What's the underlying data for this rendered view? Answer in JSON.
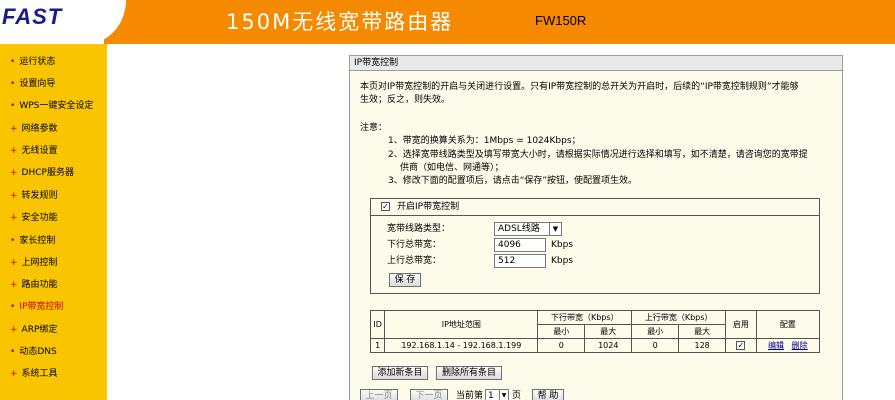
{
  "header": {
    "logo_text": "FAST",
    "title": "150M无线宽带路由器",
    "model": "FW150R",
    "brand_color": "#f58a00"
  },
  "sidebar": {
    "items": [
      {
        "label": "运行状态"
      },
      {
        "label": "设置向导"
      },
      {
        "label": "WPS一键安全设定"
      },
      {
        "label": "网络参数"
      },
      {
        "label": "无线设置"
      },
      {
        "label": "DHCP服务器"
      },
      {
        "label": "转发规则"
      },
      {
        "label": "安全功能"
      },
      {
        "label": "家长控制"
      },
      {
        "label": "上网控制"
      },
      {
        "label": "路由功能"
      },
      {
        "label": "IP带宽控制",
        "active": true
      },
      {
        "label": "ARP绑定"
      },
      {
        "label": "动态DNS"
      },
      {
        "label": "系统工具"
      }
    ]
  },
  "panel": {
    "title": "IP带宽控制",
    "intro_line1": "本页对IP带宽控制的开启与关闭进行设置。只有IP带宽控制的总开关为开启时，后续的“IP带宽控制规则”才能够",
    "intro_line2": "生效；反之，则失效。",
    "note_label": "注意：",
    "note1": "1、带宽的换算关系为：1Mbps = 1024Kbps；",
    "note2a": "2、选择宽带线路类型及填写带宽大小时，请根据实际情况进行选择和填写，如不清楚，请咨询您的宽带提",
    "note2b": "供商（如电信、网通等）；",
    "note3": "3、修改下面的配置项后，请点击“保存”按钮，使配置项生效。"
  },
  "settings": {
    "enable_label": "开启IP带宽控制",
    "enable_checked": "✓",
    "line_type_label": "宽带线路类型：",
    "line_type_value": "ADSL线路",
    "down_label": "下行总带宽：",
    "down_value": "4096",
    "up_label": "上行总带宽：",
    "up_value": "512",
    "unit": "Kbps",
    "save_label": "保 存"
  },
  "table": {
    "h_id": "ID",
    "h_ip": "IP地址范围",
    "h_down": "下行带宽（Kbps）",
    "h_up": "上行带宽（Kbps）",
    "h_enable": "启用",
    "h_config": "配置",
    "h_min": "最小",
    "h_max": "最大",
    "rows": [
      {
        "id": "1",
        "ip": "192.168.1.14 - 192.168.1.199",
        "down_min": "0",
        "down_max": "1024",
        "up_min": "0",
        "up_max": "128",
        "enabled": "✓",
        "edit": "编辑",
        "delete": "删除"
      }
    ]
  },
  "actions": {
    "add_label": "添加新条目",
    "delete_all_label": "删除所有条目",
    "prev_label": "上一页",
    "next_label": "下一页",
    "page_prefix": "当前第",
    "page_value": "1",
    "page_suffix": "页",
    "help_label": "帮 助"
  }
}
